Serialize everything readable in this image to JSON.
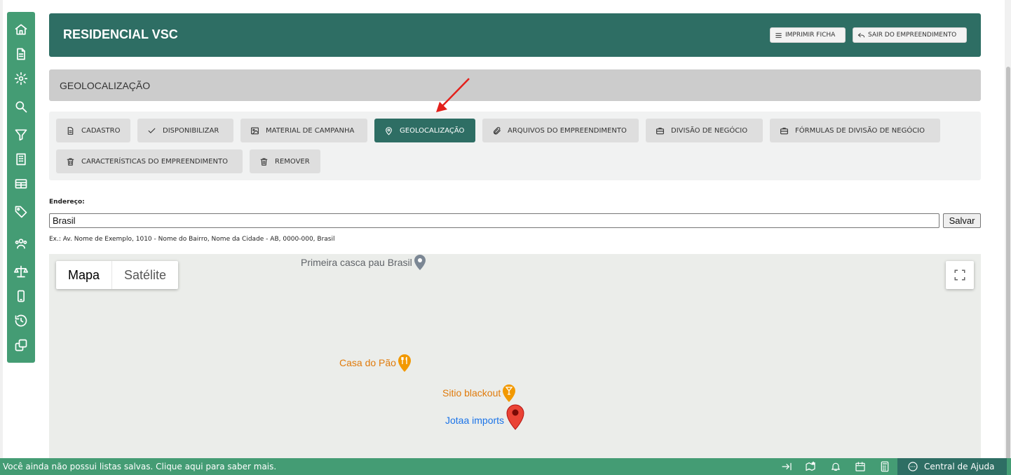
{
  "header": {
    "title": "RESIDENCIAL VSC",
    "print_label": "IMPRIMIR FICHA",
    "exit_label": "SAIR DO EMPREENDIMENTO"
  },
  "section": {
    "title": "GEOLOCALIZAÇÃO"
  },
  "tabs": [
    {
      "label": "CADASTRO",
      "icon": "document-icon"
    },
    {
      "label": "DISPONIBILIZAR",
      "icon": "check-icon"
    },
    {
      "label": "MATERIAL DE CAMPANHA",
      "icon": "image-icon"
    },
    {
      "label": "GEOLOCALIZAÇÃO",
      "icon": "map-pin-icon",
      "active": true
    },
    {
      "label": "ARQUIVOS DO EMPREENDIMENTO",
      "icon": "paperclip-icon"
    },
    {
      "label": "DIVISÃO DE NEGÓCIO",
      "icon": "briefcase-icon"
    },
    {
      "label": "FÓRMULAS DE DIVISÃO DE NEGÓCIO",
      "icon": "briefcase-icon"
    },
    {
      "label": "CARACTERÍSTICAS DO EMPREENDIMENTO",
      "icon": "trash-icon"
    },
    {
      "label": "REMOVER",
      "icon": "trash-icon"
    }
  ],
  "address": {
    "label": "Endereço:",
    "value": "Brasil",
    "save_label": "Salvar",
    "hint": "Ex.: Av. Nome de Exemplo, 1010 - Nome do Bairro, Nome da Cidade - AB, 0000-000, Brasil"
  },
  "map": {
    "type_options": [
      "Mapa",
      "Satélite"
    ],
    "selected_type": "Mapa",
    "pois": [
      {
        "label": "Primeira casca pau Brasil",
        "color": "#5f6368"
      },
      {
        "label": "Casa do Pão",
        "color": "#e8830c"
      },
      {
        "label": "Sitio blackout",
        "color": "#e8830c"
      },
      {
        "label": "Jotaa imports",
        "color": "#1a73e8"
      }
    ],
    "marker_color": "#ea4335"
  },
  "footer": {
    "message": "Você ainda não possui listas salvas. Clique aqui para saber mais.",
    "help_label": "Central de Ajuda"
  },
  "colors": {
    "primary_dark": "#2e6e64",
    "primary": "#449c74",
    "annotation_arrow": "#e3201b"
  }
}
